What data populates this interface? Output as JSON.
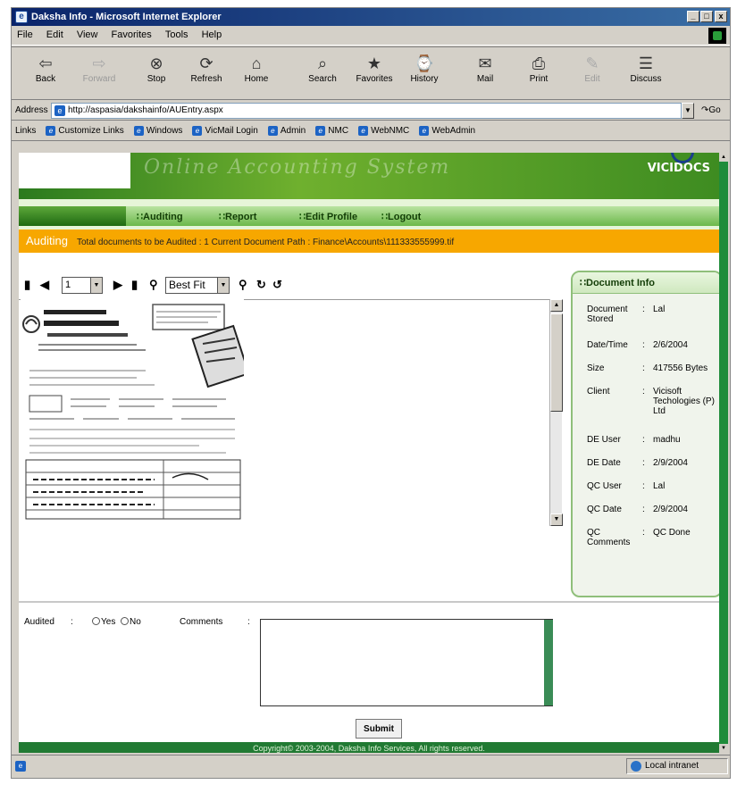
{
  "window": {
    "title": "Daksha Info - Microsoft Internet Explorer",
    "controls": [
      "_",
      "□",
      "x"
    ]
  },
  "menu": [
    "File",
    "Edit",
    "View",
    "Favorites",
    "Tools",
    "Help"
  ],
  "toolbar": [
    {
      "label": "Back",
      "icon": "back-arrow-icon",
      "glyph": "⇦"
    },
    {
      "label": "Forward",
      "icon": "forward-arrow-icon",
      "glyph": "⇨"
    },
    {
      "label": "Stop",
      "icon": "stop-icon",
      "glyph": "⊗"
    },
    {
      "label": "Refresh",
      "icon": "refresh-icon",
      "glyph": "⟳"
    },
    {
      "label": "Home",
      "icon": "home-icon",
      "glyph": "⌂"
    },
    {
      "label": "Search",
      "icon": "search-icon",
      "glyph": "⌕"
    },
    {
      "label": "Favorites",
      "icon": "favorites-icon",
      "glyph": "★"
    },
    {
      "label": "History",
      "icon": "history-icon",
      "glyph": "⌚"
    },
    {
      "label": "Mail",
      "icon": "mail-icon",
      "glyph": "✉"
    },
    {
      "label": "Print",
      "icon": "print-icon",
      "glyph": "⎙"
    },
    {
      "label": "Edit",
      "icon": "edit-icon",
      "glyph": "✎"
    },
    {
      "label": "Discuss",
      "icon": "discuss-icon",
      "glyph": "☰"
    }
  ],
  "address": {
    "label": "Address",
    "url": "http://aspasia/dakshainfo/AUEntry.aspx",
    "go_label": "Go"
  },
  "links": {
    "label": "Links",
    "items": [
      "Customize Links",
      "Windows",
      "VicMail Login",
      "Admin",
      "NMC",
      "WebNMC",
      "WebAdmin"
    ]
  },
  "banner": {
    "tagline": "Online Accounting System",
    "logo": "VICIDOCS"
  },
  "nav": [
    "Auditing",
    "Report",
    "Edit Profile",
    "Logout"
  ],
  "status": {
    "mode": "Auditing",
    "text": "Total documents to be Audited : 1    Current Document Path  : Finance\\Accounts\\111333555999.tif"
  },
  "viewer": {
    "page": "1",
    "zoom": "Best Fit"
  },
  "document_info": {
    "title": "Document Info",
    "rows": [
      {
        "key": "Document Stored",
        "value": "Lal"
      },
      {
        "key": "Date/Time",
        "value": "2/6/2004"
      },
      {
        "key": "Size",
        "value": "417556 Bytes"
      },
      {
        "key": "Client",
        "value": "Vicisoft Techologies (P) Ltd"
      },
      {
        "key": "DE User",
        "value": "madhu"
      },
      {
        "key": "DE Date",
        "value": "2/9/2004"
      },
      {
        "key": "QC User",
        "value": "Lal"
      },
      {
        "key": "QC Date",
        "value": "2/9/2004"
      },
      {
        "key": "QC Comments",
        "value": "QC Done"
      }
    ]
  },
  "form": {
    "audited_label": "Audited",
    "yes_label": "Yes",
    "no_label": "No",
    "comments_label": "Comments",
    "submit_label": "Submit"
  },
  "footer": "Copyright© 2003-2004, Daksha Info Services, All rights reserved.",
  "statusbar": {
    "zone": "Local intranet"
  },
  "colors": {
    "accent_green": "#217a33",
    "status_orange": "#f7a700",
    "title_blue": "#0a246a"
  }
}
